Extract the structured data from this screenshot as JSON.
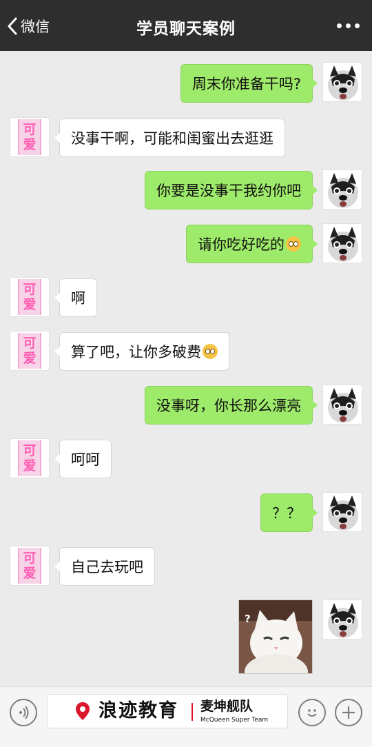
{
  "header": {
    "back_label": "微信",
    "title": "学员聊天案例"
  },
  "avatars": {
    "left_text_top": "可",
    "left_text_bottom": "爱",
    "right_icon": "husky-dog-avatar"
  },
  "messages": [
    {
      "side": "sent",
      "text": "周末你准备干吗?"
    },
    {
      "side": "recv",
      "text": "没事干啊，可能和闺蜜出去逛逛"
    },
    {
      "side": "sent",
      "text": "你要是没事干我约你吧"
    },
    {
      "side": "sent",
      "text": "请你吃好吃的",
      "emoji": "drooling-face"
    },
    {
      "side": "recv",
      "text": "啊"
    },
    {
      "side": "recv",
      "text": "算了吧，让你多破费",
      "emoji": "flushed-face"
    },
    {
      "side": "sent",
      "text": "没事呀，你长那么漂亮"
    },
    {
      "side": "recv",
      "text": "呵呵"
    },
    {
      "side": "sent",
      "text": "？？"
    },
    {
      "side": "recv",
      "text": "自己去玩吧"
    },
    {
      "side": "sent",
      "image": "confused-cat-sticker",
      "marks": [
        "?",
        "?"
      ]
    }
  ],
  "bottombar": {
    "brand_name": "浪迹教育",
    "team_cn": "麦坤舰队",
    "team_en": "McQueen Super Team",
    "accent": "#d9192b"
  }
}
